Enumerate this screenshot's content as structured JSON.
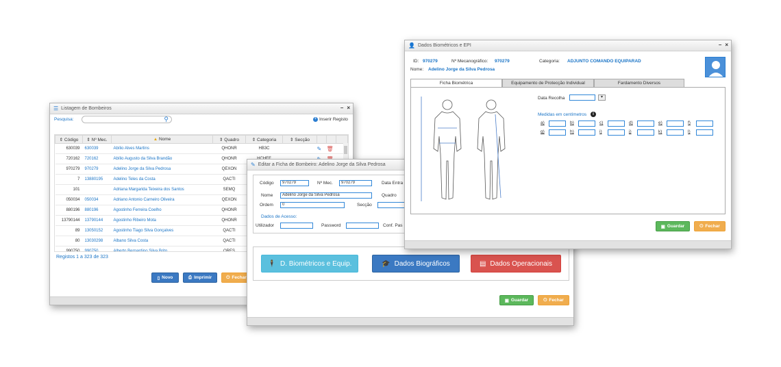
{
  "listagem": {
    "title": "Listagem de Bombeiros",
    "search_label": "Pesquisa:",
    "search_value": "",
    "insert_label": "Inserir Registo",
    "columns": [
      "Código",
      "Nº Mec.",
      "Nome",
      "Quadro",
      "Categoria",
      "Secção"
    ],
    "rows": [
      {
        "codigo": "630039",
        "mec": "630039",
        "nome": "Abílio Alves Martins",
        "quadro": "QHONR",
        "categoria": "HB3C",
        "seccao": ""
      },
      {
        "codigo": "720162",
        "mec": "720162",
        "nome": "Abílio Augusto da Silva Brandão",
        "quadro": "QHONR",
        "categoria": "HCHEF",
        "seccao": ""
      },
      {
        "codigo": "970279",
        "mec": "970279",
        "nome": "Adelino Jorge da Silva Pedrosa",
        "quadro": "QEXON",
        "categoria": "",
        "seccao": ""
      },
      {
        "codigo": "7",
        "mec": "13880195",
        "nome": "Adelino Teles da Costa",
        "quadro": "QACTI",
        "categoria": "",
        "seccao": ""
      },
      {
        "codigo": "101",
        "mec": "",
        "nome": "Adriana Margarida Teixeira dos Santos",
        "quadro": "SEMQ",
        "categoria": "",
        "seccao": ""
      },
      {
        "codigo": "050034",
        "mec": "050034",
        "nome": "Adriano Antonio Carneiro Oliveira",
        "quadro": "QEXON",
        "categoria": "",
        "seccao": ""
      },
      {
        "codigo": "880196",
        "mec": "880196",
        "nome": "Agostinho Ferreira Coelho",
        "quadro": "QHONR",
        "categoria": "",
        "seccao": ""
      },
      {
        "codigo": "13790144",
        "mec": "13790144",
        "nome": "Agostinho Ribeiro Mota",
        "quadro": "QHONR",
        "categoria": "",
        "seccao": ""
      },
      {
        "codigo": "89",
        "mec": "13050152",
        "nome": "Agostinho Tiago Silva Gonçalves",
        "quadro": "QACTI",
        "categoria": "",
        "seccao": ""
      },
      {
        "codigo": "80",
        "mec": "13030298",
        "nome": "Albano Silva Costa",
        "quadro": "QACTI",
        "categoria": "",
        "seccao": ""
      },
      {
        "codigo": "990750",
        "mec": "990750",
        "nome": "Alberto Bernardino Silva Brito",
        "quadro": "QRES",
        "categoria": "",
        "seccao": ""
      }
    ],
    "records_label": "Registos 1 a 323 de 323",
    "btn_novo": "Novo",
    "btn_imprimir": "Imprimir",
    "btn_fechar": "Fechar"
  },
  "editar": {
    "title": "Editar a Ficha de Bombeiro: Adelino Jorge da Silva Pedrosa",
    "codigo_label": "Código",
    "codigo_value": "970279",
    "mec_label": "Nº Mec.",
    "mec_value": "970279",
    "data_entrada_label": "Data Entra",
    "nome_label": "Nome",
    "nome_value": "Adelino Jorge da Silva Pedrosa",
    "quadro_label": "Quadro",
    "ordem_label": "Ordem",
    "ordem_value": "0",
    "seccao_label": "Secção",
    "acesso_title": "Dados de Acesso:",
    "utilizador_label": "Utilizador",
    "password_label": "Password",
    "conf_label": "Conf. Pas",
    "btn_biometricos": "D. Biométricos e Equip.",
    "btn_biograficos": "Dados Biográficos",
    "btn_operacionais": "Dados Operacionais",
    "btn_guardar": "Guardar",
    "btn_fechar": "Fechar"
  },
  "bio": {
    "title": "Dados Biométricos e EPI",
    "id_label": "ID:",
    "id_value": "970279",
    "mec_label": "Nº Mecanográfico:",
    "mec_value": "970279",
    "categoria_label": "Categoria:",
    "categoria_value": "ADJUNTO COMANDO EQUIPARAD",
    "nome_label": "Nome:",
    "nome_value": "Adelino Jorge da Silva Pedrosa",
    "tabs": [
      "Ficha Biométrica",
      "Equipamento de Protecção Individual",
      "Fardamento Diversos"
    ],
    "data_recolha_label": "Data Recolha",
    "medidas_label": "Medidas em centímetros",
    "row1": [
      "a)",
      "b)",
      "c)",
      "d)",
      "e)",
      "f)"
    ],
    "row2": [
      "g)",
      "h)",
      "i)",
      "j)",
      "k)",
      "l)"
    ],
    "btn_guardar": "Guardar",
    "btn_fechar": "Fechar"
  }
}
